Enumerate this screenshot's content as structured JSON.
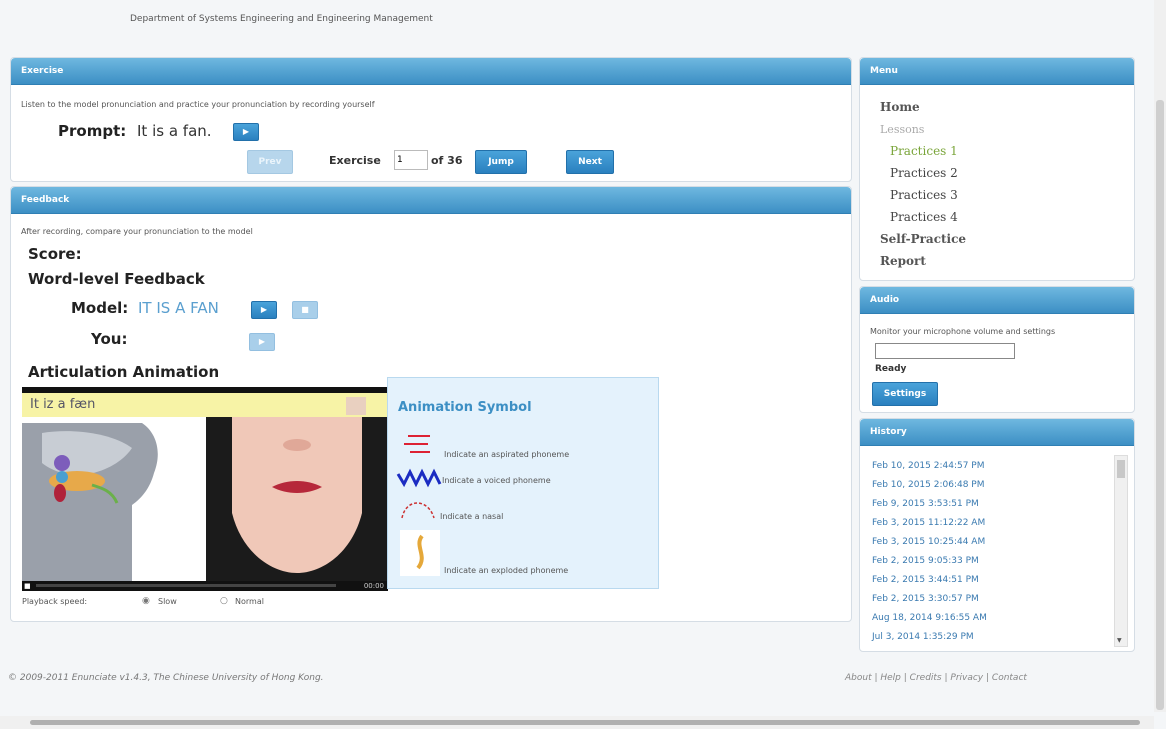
{
  "header": {
    "department": "Department of Systems Engineering and Engineering Management"
  },
  "exercise": {
    "title": "Exercise",
    "instruction": "Listen to the model pronunciation and practice your pronunciation by recording yourself",
    "prompt_label": "Prompt:",
    "prompt_text": "It is a fan.",
    "prev_label": "Prev",
    "exercise_label": "Exercise",
    "exercise_value": "1",
    "of_label": "of 36",
    "jump_label": "Jump",
    "next_label": "Next"
  },
  "feedback": {
    "title": "Feedback",
    "instruction": "After recording, compare your pronunciation to the model",
    "score_label": "Score:",
    "word_level_label": "Word-level Feedback",
    "model_label": "Model:",
    "model_text": "IT IS A FAN",
    "you_label": "You:",
    "articulation_label": "Articulation Animation",
    "video_caption": "It iz a fæn",
    "time_readout": "00:00",
    "playback_label": "Playback speed:",
    "slow_label": "Slow",
    "normal_label": "Normal",
    "playback_selected": "Slow"
  },
  "symbols": {
    "title": "Animation Symbol",
    "items": [
      "Indicate an aspirated phoneme",
      "Indicate a voiced phoneme",
      "Indicate a nasal",
      "Indicate an exploded phoneme"
    ]
  },
  "menu": {
    "title": "Menu",
    "home": "Home",
    "lessons": "Lessons",
    "practices": [
      "Practices 1",
      "Practices 2",
      "Practices 3",
      "Practices 4"
    ],
    "self_practice": "Self-Practice",
    "report": "Report"
  },
  "audio": {
    "title": "Audio",
    "description": "Monitor your microphone volume and settings",
    "status": "Ready",
    "settings_label": "Settings"
  },
  "history": {
    "title": "History",
    "items": [
      "Feb 10, 2015 2:44:57 PM",
      "Feb 10, 2015 2:06:48 PM",
      "Feb 9, 2015 3:53:51 PM",
      "Feb 3, 2015 11:12:22 AM",
      "Feb 3, 2015 10:25:44 AM",
      "Feb 2, 2015 9:05:33 PM",
      "Feb 2, 2015 3:44:51 PM",
      "Feb 2, 2015 3:30:57 PM",
      "Aug 18, 2014 9:16:55 AM",
      "Jul 3, 2014 1:35:29 PM"
    ]
  },
  "footer": {
    "copyright": "© 2009-2011 Enunciate v1.4.3, The Chinese University of Hong Kong.",
    "links": [
      "About",
      "Help",
      "Credits",
      "Privacy",
      "Contact"
    ]
  },
  "colors": {
    "header_blue": "#3c8fc4",
    "accent_green": "#7aa53a",
    "link_blue": "#3a7ab0"
  }
}
